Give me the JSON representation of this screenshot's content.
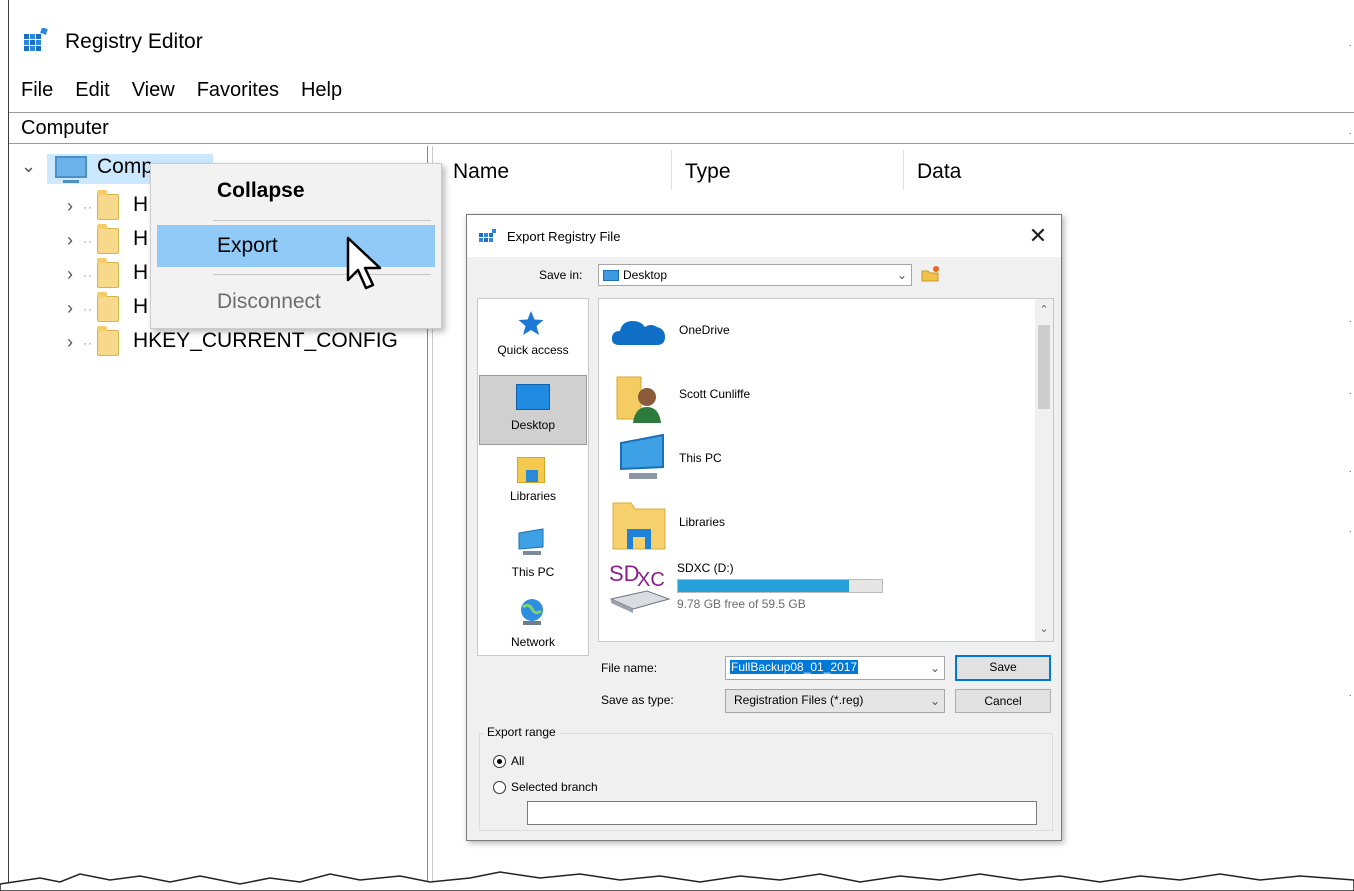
{
  "window": {
    "title": "Registry Editor",
    "icon": "registry-editor-icon"
  },
  "menu": [
    "File",
    "Edit",
    "View",
    "Favorites",
    "Help"
  ],
  "address": "Computer",
  "tree": {
    "root": "Comp",
    "partial_label": "H",
    "last_item": "HKEY_CURRENT_CONFIG"
  },
  "columns": [
    "Name",
    "Type",
    "Data"
  ],
  "context_menu": {
    "items": [
      {
        "label": "Collapse",
        "style": "bold"
      },
      {
        "label": "Export",
        "state": "highlighted"
      },
      {
        "label": "Disconnect",
        "state": "disabled"
      }
    ]
  },
  "dialog": {
    "title": "Export Registry File",
    "save_in_label": "Save in:",
    "save_in_value": "Desktop",
    "places": [
      "Quick access",
      "Desktop",
      "Libraries",
      "This PC",
      "Network"
    ],
    "files": [
      {
        "name": "OneDrive",
        "icon": "onedrive-icon"
      },
      {
        "name": "Scott Cunliffe",
        "icon": "user-folder-icon"
      },
      {
        "name": "This PC",
        "icon": "this-pc-icon"
      },
      {
        "name": "Libraries",
        "icon": "libraries-icon"
      },
      {
        "name": "SDXC (D:)",
        "icon": "sd-card-icon",
        "free_text": "9.78 GB free of 59.5 GB",
        "used_fraction": 0.836
      }
    ],
    "sd_logo": {
      "sd": "SD",
      "xc": "XC"
    },
    "file_name_label": "File name:",
    "file_name_value": "FullBackup08_01_2017",
    "save_as_type_label": "Save as type:",
    "save_as_type_value": "Registration Files (*.reg)",
    "save_button": "Save",
    "cancel_button": "Cancel",
    "export_range": {
      "legend": "Export range",
      "options": [
        "All",
        "Selected branch"
      ],
      "selected": "All",
      "branch_value": ""
    }
  },
  "colors": {
    "selection": "#cce8ff",
    "menu_highlight": "#91c9f7",
    "accent": "#0078d7",
    "progress": "#26a0da"
  }
}
